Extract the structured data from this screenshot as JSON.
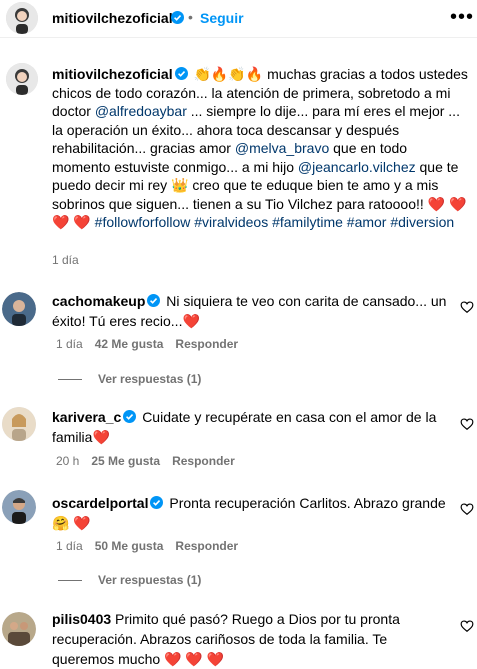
{
  "header": {
    "username": "mitiovilchezoficial",
    "separator": "•",
    "follow_label": "Seguir",
    "more_label": "•••"
  },
  "post": {
    "username": "mitiovilchezoficial",
    "emoji_1": "👏🔥👏🔥",
    "text_1": " muchas gracias a todos ustedes chicos de todo corazón... la atención de primera, sobretodo a mi doctor ",
    "mention_1": "@alfredoaybar",
    "text_2": " ... siempre lo dije... para mí eres el mejor ... la operación un éxito... ahora toca descansar y después rehabilitación... gracias amor ",
    "mention_2": "@melva_bravo",
    "text_3": " que en todo momento estuviste conmigo... a mi hijo ",
    "mention_3": "@jeancarlo.vilchez",
    "text_4": " que te puedo decir mi rey ",
    "crown": "👑",
    "text_5": " creo que te eduque bien te amo y a mis sobrinos que siguen... tienen a su Tio Vilchez para ratoooo!! ",
    "hearts": "❤️ ❤️ ❤️ ❤️",
    "hashtag_1": "#followforfollow",
    "hashtag_2": "#viralvideos",
    "hashtag_3": "#familytime",
    "hashtag_4": "#amor",
    "hashtag_5": "#diversion",
    "time": "1 día"
  },
  "comments": [
    {
      "username": "cachomakeup",
      "text": "Ni siquiera te veo con carita de cansado... un éxito! Tú eres recio...",
      "emoji": "❤️",
      "time": "1 día",
      "likes": "42 Me gusta",
      "reply_label": "Responder",
      "view_replies": "Ver respuestas (1)"
    },
    {
      "username": "karivera_c",
      "text": "Cuidate y recupérate en casa con el amor de la familia",
      "emoji": "❤️",
      "time": "20 h",
      "likes": "25 Me gusta",
      "reply_label": "Responder"
    },
    {
      "username": "oscardelportal",
      "text": "Pronta recuperación Carlitos. Abrazo grande",
      "emoji": "🤗 ❤️",
      "time": "1 día",
      "likes": "50 Me gusta",
      "reply_label": "Responder",
      "view_replies": "Ver respuestas (1)"
    },
    {
      "username": "pilis0403",
      "text": "Primito qué pasó? Ruego a Dios por tu pronta recuperación. Abrazos cariñosos de toda la familia. Te queremos mucho",
      "emoji": "❤️ ❤️ ❤️"
    }
  ],
  "colors": {
    "link": "#00376b",
    "follow": "#0095f6",
    "verified": "#0095f6",
    "muted": "#737373",
    "heart": "#ff3040"
  },
  "icons": [
    "verified-badge-icon",
    "more-options-icon",
    "heart-outline-icon",
    "avatar-icon"
  ]
}
